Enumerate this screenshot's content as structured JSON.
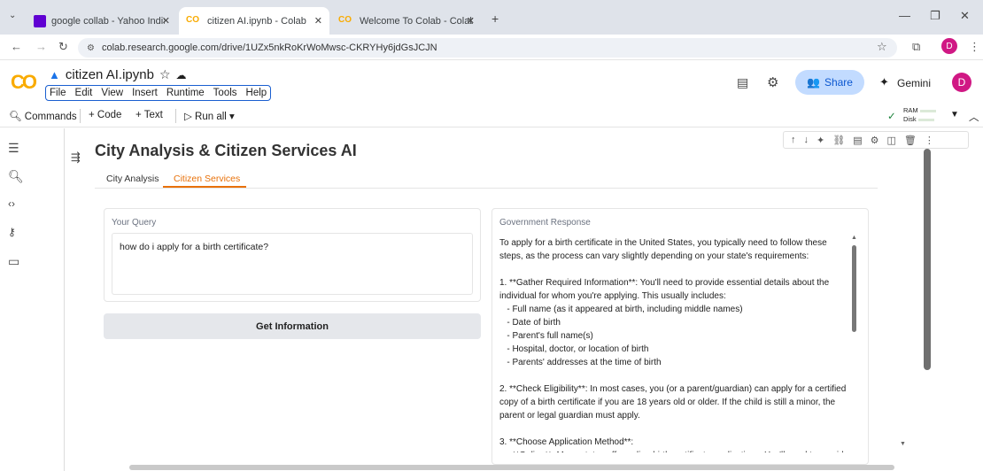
{
  "browser": {
    "tabs": [
      {
        "title": "google collab - Yahoo India Se",
        "icon_color": "#6001d2"
      },
      {
        "title": "citizen AI.ipynb - Colab",
        "icon_color": "#f9ab00"
      },
      {
        "title": "Welcome To Colab - Colab",
        "icon_color": "#f9ab00"
      }
    ],
    "url": "colab.research.google.com/drive/1UZx5nkRoKrWoMwsc-CKRYHy6jdGsJCJN",
    "profile_initial": "D"
  },
  "colab": {
    "notebook_name": "citizen AI.ipynb",
    "menu": [
      "File",
      "Edit",
      "View",
      "Insert",
      "Runtime",
      "Tools",
      "Help"
    ],
    "share_label": "Share",
    "gemini_label": "Gemini",
    "avatar_initial": "D",
    "toolbar": {
      "commands": "Commands",
      "code": "+ Code",
      "text": "+ Text",
      "run_all": "Run all",
      "ram": "RAM",
      "disk": "Disk"
    }
  },
  "app": {
    "title": "City Analysis & Citizen Services AI",
    "tabs": [
      "City Analysis",
      "Citizen Services"
    ],
    "active_tab": 1,
    "query_label": "Your Query",
    "query_value": "how do i apply for a birth certificate?",
    "button_label": "Get Information",
    "response_label": "Government Response",
    "response_lines": [
      "To apply for a birth certificate in the United States, you typically need to follow these",
      "steps, as the process can vary slightly depending on your state's requirements:",
      "",
      "1. **Gather Required Information**: You'll need to provide essential details about the",
      "individual for whom you're applying. This usually includes:",
      "   - Full name (as it appeared at birth, including middle names)",
      "   - Date of birth",
      "   - Parent's full name(s)",
      "   - Hospital, doctor, or location of birth",
      "   - Parents' addresses at the time of birth",
      "",
      "2. **Check Eligibility**: In most cases, you (or a parent/guardian) can apply for a certified",
      "copy of a birth certificate if you are 18 years old or older. If the child is still a minor, the",
      "parent or legal guardian must apply.",
      "",
      "3. **Choose Application Method**:",
      "   - **Online**: Many states offer online birth certificate applications. You'll need to provide"
    ]
  },
  "colors": {
    "accent_orange": "#e8710a",
    "share_bg": "#c2dbff",
    "share_text": "#0b57d0"
  }
}
